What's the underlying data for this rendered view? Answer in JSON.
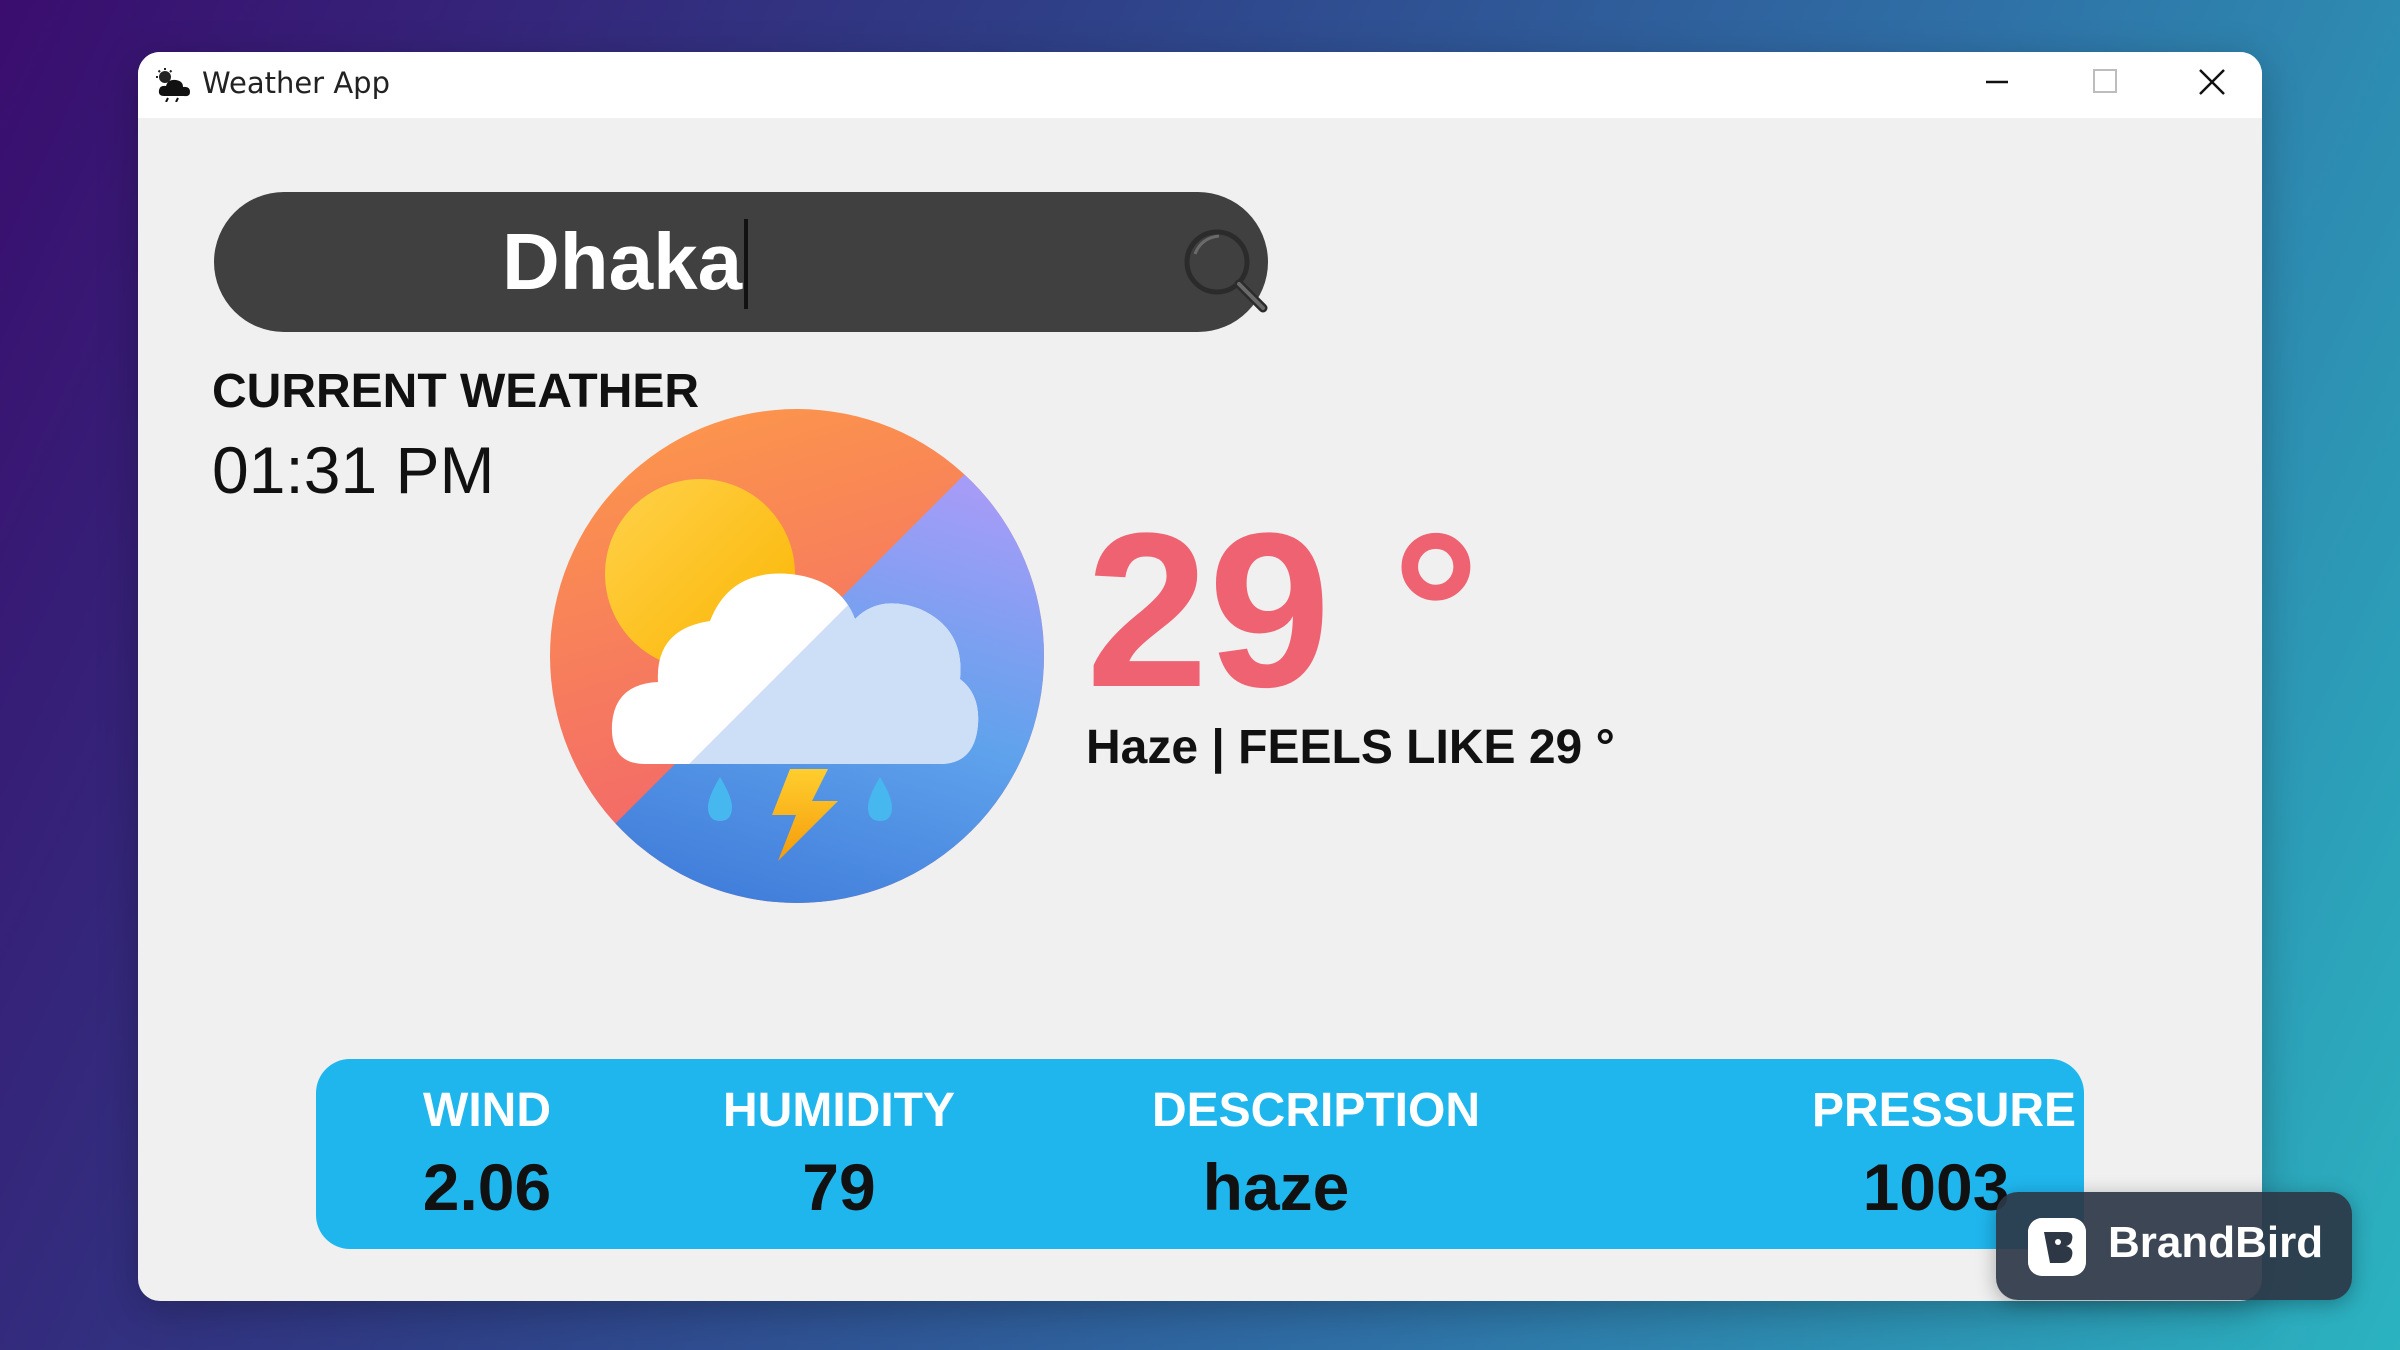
{
  "window": {
    "title": "Weather App",
    "icon": "cloud-sun-icon",
    "controls": [
      "minimize-icon",
      "maximize-icon",
      "close-icon"
    ]
  },
  "search": {
    "value": "Dhaka",
    "icon": "search-icon"
  },
  "current": {
    "label": "CURRENT WEATHER",
    "time": "01:31 PM",
    "icon": "thunderstorm-icon",
    "temperature": "29 °",
    "summary": "Haze | FEELS LIKE 29 °"
  },
  "stats": [
    {
      "label": "WIND",
      "value": "2.06"
    },
    {
      "label": "HUMIDITY",
      "value": "79"
    },
    {
      "label": "DESCRIPTION",
      "value": "haze"
    },
    {
      "label": "PRESSURE",
      "value": "1003"
    }
  ],
  "badge": {
    "text": "BrandBird",
    "icon": "brandbird-logo-icon"
  },
  "colors": {
    "temperature": "#ef6272",
    "stats_bar": "#1fb6ee",
    "search_bar": "#404040",
    "window_bg": "#f0f0f0"
  }
}
